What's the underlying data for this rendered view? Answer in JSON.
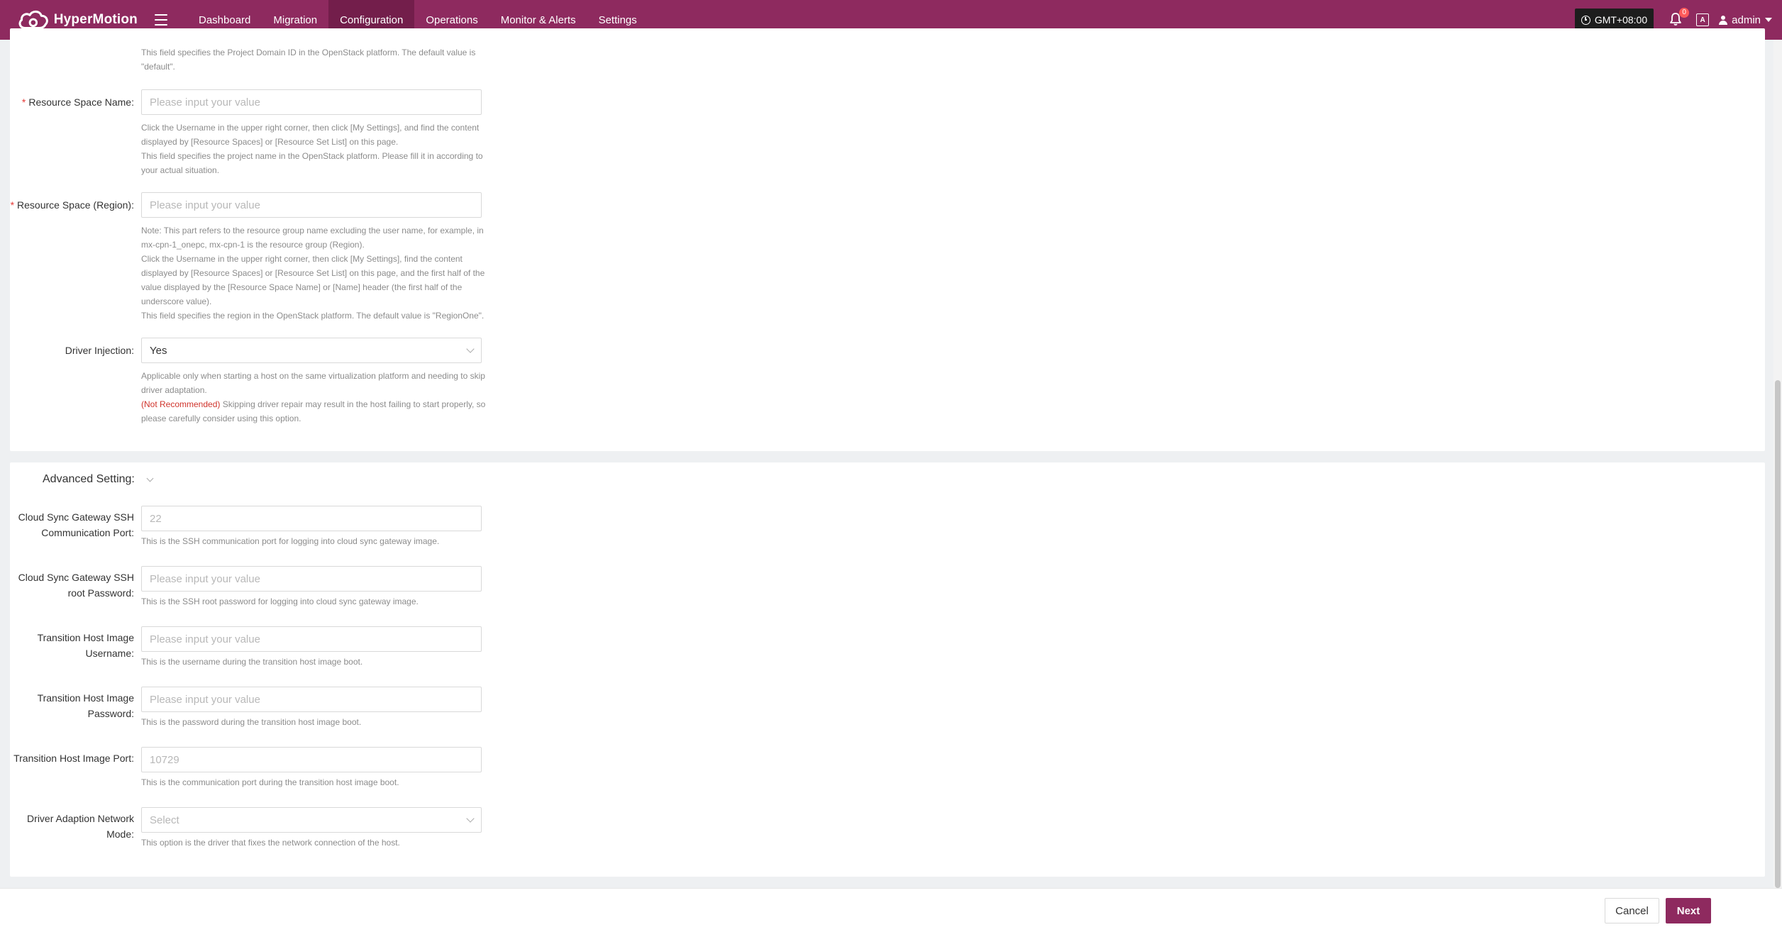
{
  "app": {
    "name": "HyperMotion",
    "nav": [
      {
        "label": "Dashboard"
      },
      {
        "label": "Migration"
      },
      {
        "label": "Configuration"
      },
      {
        "label": "Operations"
      },
      {
        "label": "Monitor & Alerts"
      },
      {
        "label": "Settings"
      }
    ],
    "active_nav": "Configuration",
    "timezone": "GMT+08:00",
    "notification_count": "0",
    "lang_badge": "A",
    "user": "admin",
    "brand_color": "#8e2a5f"
  },
  "section1": {
    "partial_help": "This field specifies the Project Domain ID in the OpenStack platform. The default value is \"default\".",
    "resource_space_name": {
      "label": "Resource Space Name:",
      "required": "*",
      "placeholder": "Please input your value",
      "help_1": "Click the Username in the upper right corner, then click [My Settings], and find the content displayed by [Resource Spaces] or [Resource Set List] on this page.",
      "help_2": "This field specifies the project name in the OpenStack platform. Please fill it in according to your actual situation."
    },
    "resource_space_region": {
      "label": "Resource Space (Region):",
      "required": "*",
      "placeholder": "Please input your value",
      "help_1": "Note: This part refers to the resource group name excluding the user name, for example, in mx-cpn-1_onepc, mx-cpn-1 is the resource group (Region).",
      "help_2": "Click the Username in the upper right corner, then click [My Settings], find the content displayed by [Resource Spaces] or [Resource Set List] on this page, and the first half of the value displayed by the [Resource Space Name] or [Name] header (the first half of the underscore value).",
      "help_3": "This field specifies the region in the OpenStack platform. The default value is \"RegionOne\"."
    },
    "driver_injection": {
      "label": "Driver Injection:",
      "value": "Yes",
      "help_1": "Applicable only when starting a host on the same virtualization platform and needing to skip driver adaptation.",
      "warn": "(Not Recommended)",
      "help_2": "Skipping driver repair may result in the host failing to start properly, so please carefully consider using this option."
    }
  },
  "advanced": {
    "title": "Advanced Setting:",
    "ssh_port": {
      "label": "Cloud Sync Gateway SSH Communication Port:",
      "placeholder": "22",
      "help": "This is the SSH communication port for logging into cloud sync gateway image."
    },
    "ssh_password": {
      "label": "Cloud Sync Gateway SSH root Password:",
      "placeholder": "Please input your value",
      "help": "This is the SSH root password for logging into cloud sync gateway image."
    },
    "th_username": {
      "label": "Transition Host Image Username:",
      "placeholder": "Please input your value",
      "help": "This is the username during the transition host image boot."
    },
    "th_password": {
      "label": "Transition Host Image Password:",
      "placeholder": "Please input your value",
      "help": "This is the password during the transition host image boot."
    },
    "th_port": {
      "label": "Transition Host Image Port:",
      "placeholder": "10729",
      "help": "This is the communication port during the transition host image boot."
    },
    "network_mode": {
      "label": "Driver Adaption Network Mode:",
      "placeholder": "Select",
      "help": "This option is the driver that fixes the network connection of the host."
    }
  },
  "footer": {
    "cancel": "Cancel",
    "next": "Next"
  }
}
